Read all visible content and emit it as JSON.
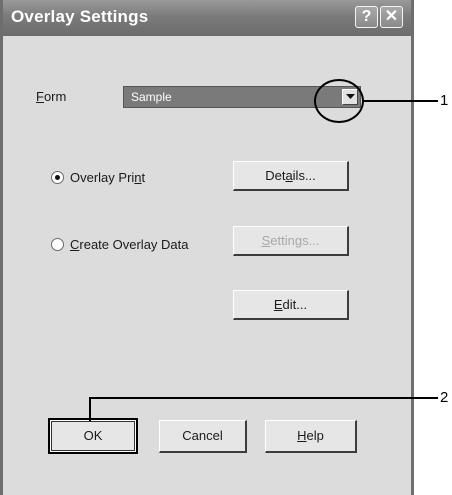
{
  "window": {
    "title": "Overlay Settings",
    "help_glyph": "?",
    "close_glyph": "✕"
  },
  "form": {
    "label_underlined": "F",
    "label_rest": "orm",
    "selected_value": "Sample"
  },
  "radios": [
    {
      "label_pre": "Overlay Pri",
      "label_u": "n",
      "label_post": "t",
      "selected": true
    },
    {
      "label_pre": "",
      "label_u": "C",
      "label_post": "reate Overlay Data",
      "selected": false
    }
  ],
  "buttons": {
    "details": {
      "pre": "Det",
      "u": "a",
      "post": "ils..."
    },
    "settings": {
      "pre": "",
      "u": "S",
      "post": "ettings...",
      "disabled": true
    },
    "edit": {
      "pre": "",
      "u": "E",
      "post": "dit..."
    },
    "ok": "OK",
    "cancel": "Cancel",
    "help": {
      "pre": "",
      "u": "H",
      "post": "elp"
    }
  },
  "callouts": [
    "1",
    "2"
  ],
  "colors": {
    "titlebar": "#7b7b7b",
    "window_bg": "#dcdcdc",
    "combo_selected_bg": "#7a7a7a"
  },
  "icons": {
    "dropdown": "chevron-down-icon",
    "help": "question-icon",
    "close": "close-icon"
  }
}
